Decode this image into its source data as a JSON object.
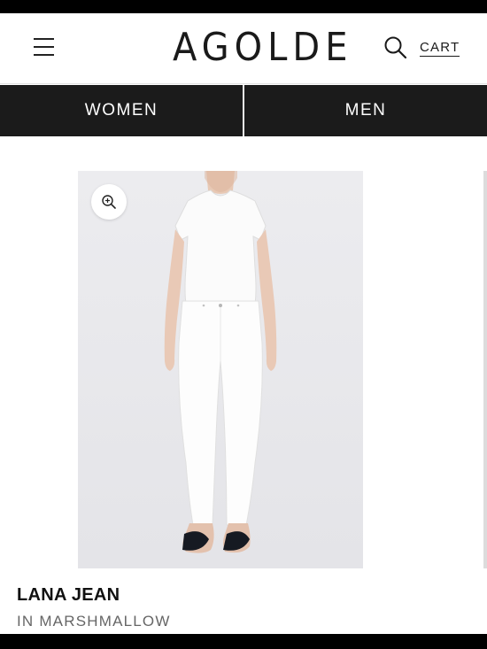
{
  "header": {
    "logo": "AGOLDE",
    "cart_label": "CART"
  },
  "nav": {
    "tabs": [
      {
        "label": "WOMEN"
      },
      {
        "label": "MEN"
      }
    ]
  },
  "product": {
    "name": "LANA JEAN",
    "color": "IN MARSHMALLOW"
  },
  "icons": {
    "menu": "hamburger-menu-icon",
    "search": "search-icon",
    "zoom": "zoom-in-icon"
  },
  "colors": {
    "nav_background": "#1b1b1b",
    "image_background": "#e9e9ec"
  }
}
